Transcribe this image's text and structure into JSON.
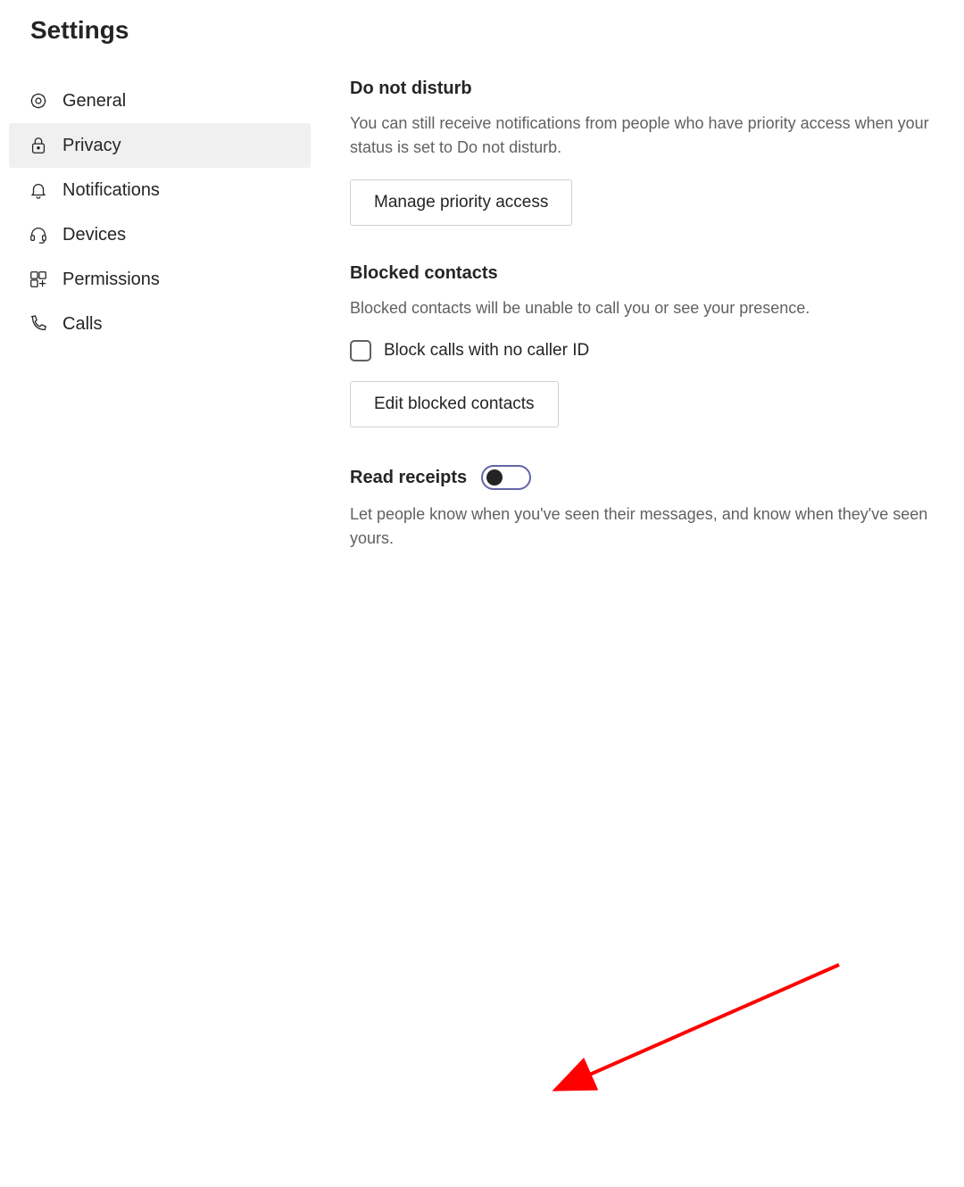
{
  "page_title": "Settings",
  "sidebar": {
    "items": [
      {
        "label": "General"
      },
      {
        "label": "Privacy"
      },
      {
        "label": "Notifications"
      },
      {
        "label": "Devices"
      },
      {
        "label": "Permissions"
      },
      {
        "label": "Calls"
      }
    ],
    "active_index": 1
  },
  "content": {
    "dnd": {
      "heading": "Do not disturb",
      "desc": "You can still receive notifications from people who have priority access when your status is set to Do not disturb.",
      "button_label": "Manage priority access"
    },
    "blocked": {
      "heading": "Blocked contacts",
      "desc": "Blocked contacts will be unable to call you or see your presence.",
      "checkbox_label": "Block calls with no caller ID",
      "button_label": "Edit blocked contacts"
    },
    "read_receipts": {
      "heading": "Read receipts",
      "desc": "Let people know when you've seen their messages, and know when they've seen yours."
    }
  }
}
